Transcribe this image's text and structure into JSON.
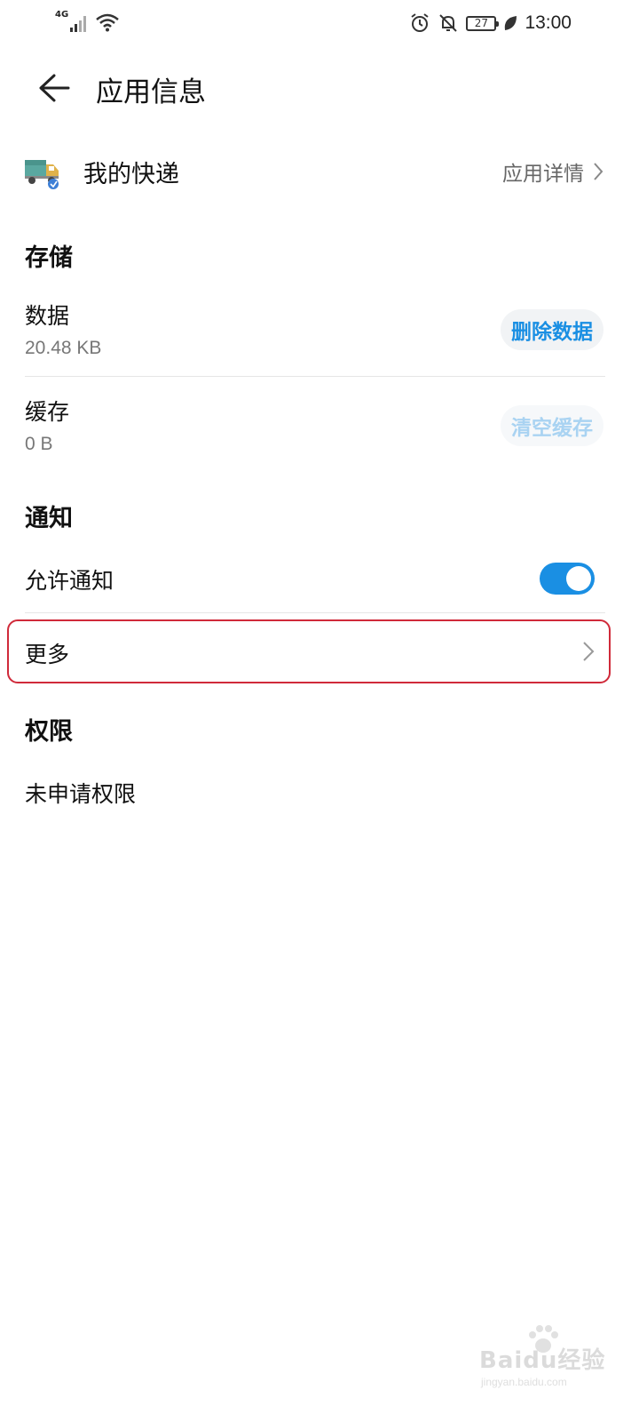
{
  "status_bar": {
    "network_type": "4G",
    "battery_level": "27",
    "time": "13:00",
    "icons": [
      "signal-icon",
      "wifi-icon",
      "alarm-icon",
      "mute-notification-icon",
      "battery-icon",
      "leaf-icon"
    ]
  },
  "header": {
    "title": "应用信息",
    "back_icon": "arrow-left-icon"
  },
  "app": {
    "name": "我的快递",
    "detail_link": "应用详情",
    "icon": "delivery-truck-icon"
  },
  "storage": {
    "title": "存储",
    "data": {
      "label": "数据",
      "size": "20.48 KB",
      "button": "删除数据"
    },
    "cache": {
      "label": "缓存",
      "size": "0 B",
      "button": "清空缓存"
    }
  },
  "notifications": {
    "title": "通知",
    "allow_label": "允许通知",
    "allow_enabled": true,
    "more_label": "更多"
  },
  "permissions": {
    "title": "权限",
    "status": "未申请权限"
  },
  "watermark": {
    "text": "Baidu经验",
    "sub": "jingyan.baidu.com"
  },
  "colors": {
    "accent": "#1a8fe3",
    "highlight_border": "#d02a3a",
    "disabled_text": "#a9d3f2"
  }
}
